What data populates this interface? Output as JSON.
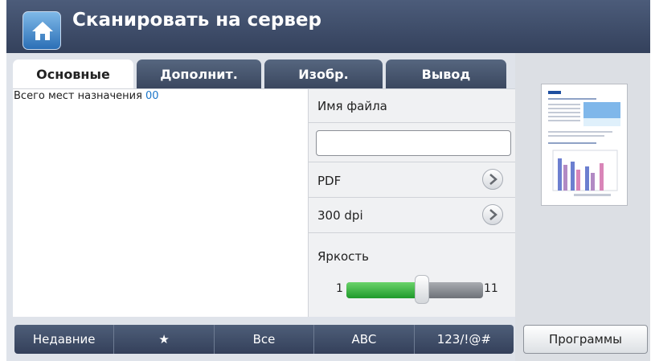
{
  "header": {
    "title": "Сканировать на сервер",
    "home_icon": "home-icon"
  },
  "tabs": [
    {
      "label": "Основные",
      "active": true
    },
    {
      "label": "Дополнит.",
      "active": false
    },
    {
      "label": "Изобр.",
      "active": false
    },
    {
      "label": "Вывод",
      "active": false
    }
  ],
  "destinations": {
    "label": "Всего мест назначения",
    "count": "00"
  },
  "options": {
    "filename_label": "Имя файла",
    "filename_value": "",
    "format": "PDF",
    "resolution": "300 dpi",
    "brightness_label": "Яркость",
    "brightness_min": "1",
    "brightness_max": "11",
    "brightness_level": 0.55
  },
  "keyboard_bar": [
    "Недавние",
    "★",
    "Все",
    "ABC",
    "123/!@#"
  ],
  "programs_button": "Программы",
  "colors": {
    "header": "#3e4b66",
    "accent": "#1a75c9",
    "slider_fill": "#2ea83a"
  }
}
